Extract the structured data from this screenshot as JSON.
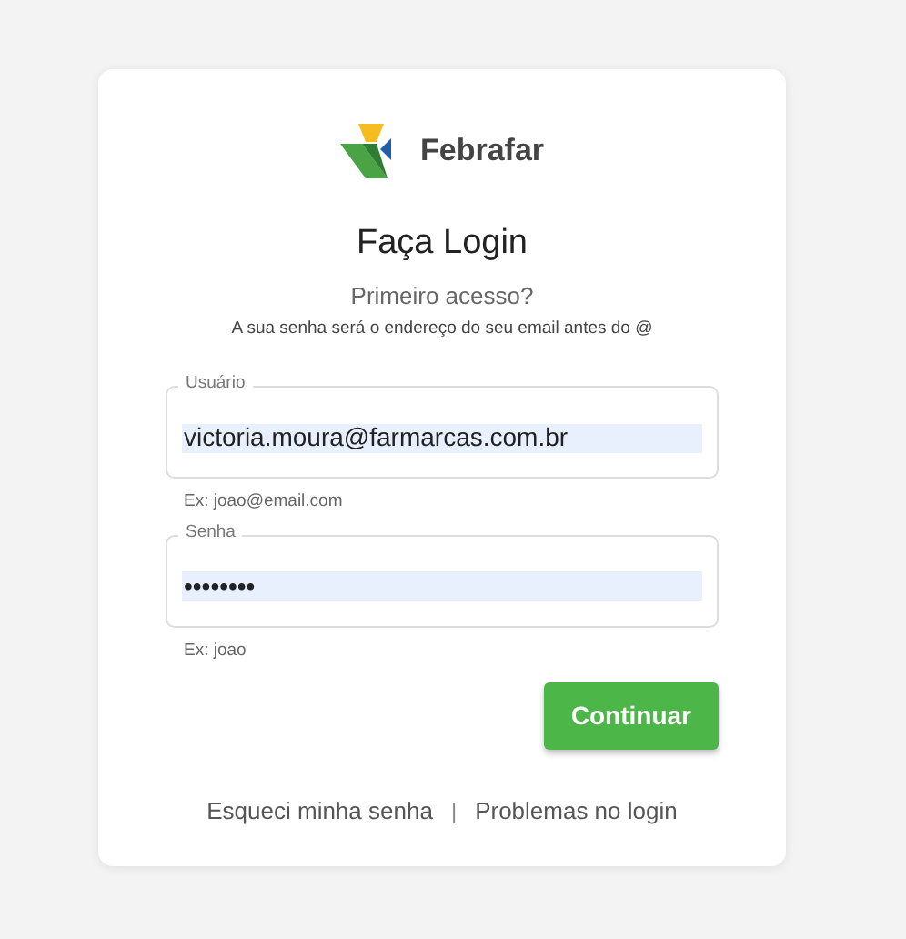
{
  "logo": {
    "name": "Febrafar"
  },
  "title": "Faça Login",
  "subtitle": "Primeiro acesso?",
  "hint": "A sua senha será o endereço do seu email antes do @",
  "fields": [
    {
      "label": "Usuário",
      "value": "victoria.moura@farmarcas.com.br",
      "helper": "Ex: joao@email.com",
      "autofilled": true
    },
    {
      "label": "Senha",
      "value": "••••••••",
      "helper": "Ex: joao",
      "autofilled": true
    }
  ],
  "button": "Continuar",
  "links": [
    "Esqueci minha senha",
    "Problemas no login"
  ],
  "separator": "|"
}
